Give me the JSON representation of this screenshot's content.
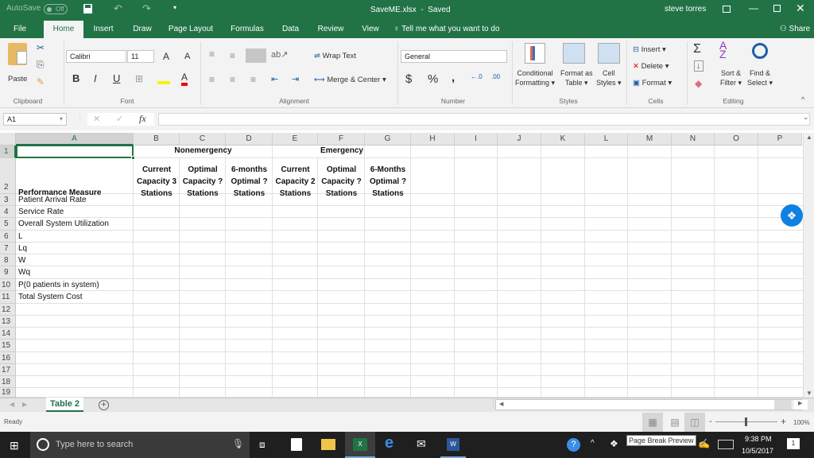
{
  "titlebar": {
    "autosave_label": "AutoSave",
    "autosave_state": "Off",
    "file_title": "SaveME.xlsx",
    "save_status": "Saved",
    "user_name": "steve torres"
  },
  "ribbon_tabs": [
    "File",
    "Home",
    "Insert",
    "Draw",
    "Page Layout",
    "Formulas",
    "Data",
    "Review",
    "View"
  ],
  "active_tab": "Home",
  "tell_me": "Tell me what you want to do",
  "share_label": "Share",
  "clipboard": {
    "paste": "Paste",
    "group": "Clipboard"
  },
  "font": {
    "name": "Calibri",
    "size": "11",
    "bold": "B",
    "italic": "I",
    "underline": "U",
    "group": "Font"
  },
  "alignment": {
    "wrap_text": "Wrap Text",
    "merge_center": "Merge & Center",
    "group": "Alignment"
  },
  "number": {
    "format": "General",
    "currency": "$",
    "percent": "%",
    "comma": ",",
    "group": "Number"
  },
  "styles": {
    "conditional_1": "Conditional",
    "conditional_2": "Formatting",
    "format_table_1": "Format as",
    "format_table_2": "Table",
    "cell_styles_1": "Cell",
    "cell_styles_2": "Styles",
    "group": "Styles"
  },
  "cells": {
    "insert": "Insert",
    "delete": "Delete",
    "format": "Format",
    "group": "Cells"
  },
  "editing": {
    "sort_1": "Sort &",
    "sort_2": "Filter",
    "find_1": "Find &",
    "find_2": "Select",
    "group": "Editing"
  },
  "formula_bar": {
    "name_box": "A1",
    "fx": "fx",
    "formula": ""
  },
  "columns": [
    "A",
    "B",
    "C",
    "D",
    "E",
    "F",
    "G",
    "H",
    "I",
    "J",
    "K",
    "L",
    "M",
    "N",
    "O",
    "P"
  ],
  "rows": [
    "1",
    "2",
    "3",
    "4",
    "5",
    "6",
    "7",
    "8",
    "9",
    "10",
    "11",
    "12",
    "13",
    "14",
    "15",
    "16",
    "17",
    "18",
    "19"
  ],
  "sheet": {
    "header_nonemergency": "Nonemergency",
    "header_emergency": "Emergency",
    "subheaders": [
      [
        "Current",
        "Capacity 3",
        "Stations"
      ],
      [
        "Optimal",
        "Capacity ?",
        "Stations"
      ],
      [
        "6-months",
        "Optimal ?",
        "Stations"
      ],
      [
        "Current",
        "Capacity 2",
        "Stations"
      ],
      [
        "Optimal",
        "Capacity ?",
        "Stations"
      ],
      [
        "6-Months",
        "Optimal ?",
        "Stations"
      ]
    ],
    "measure_header": "Performance Measure",
    "measures": [
      "Patient Arrival Rate",
      "Service Rate",
      "Overall System Utilization",
      "L",
      "Lq",
      "W",
      "Wq",
      "P(0 patients in system)",
      "Total System Cost"
    ]
  },
  "sheet_tabs": [
    "Table 2"
  ],
  "status": {
    "ready": "Ready",
    "zoom": "100%",
    "tooltip": "Page Break Preview"
  },
  "taskbar": {
    "search_placeholder": "Type here to search",
    "time": "9:38 PM",
    "date": "10/5/2017",
    "notifications": "1"
  },
  "colors": {
    "excel_green": "#217346",
    "selection": "#217346"
  }
}
